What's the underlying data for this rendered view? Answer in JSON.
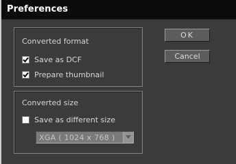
{
  "window": {
    "title": "Preferences"
  },
  "converted_format": {
    "label": "Converted format",
    "save_as_dcf": {
      "label": "Save as DCF",
      "checked": true
    },
    "prepare_thumbnail": {
      "label": "Prepare thumbnail",
      "checked": true
    }
  },
  "converted_size": {
    "label": "Converted size",
    "save_as_different_size": {
      "label": "Save as different size",
      "checked": false
    },
    "size_select": {
      "value": "XGA  ( 1024 x 768 )",
      "enabled": false
    }
  },
  "buttons": {
    "ok_label": "OK",
    "cancel_label": "Cancel"
  }
}
